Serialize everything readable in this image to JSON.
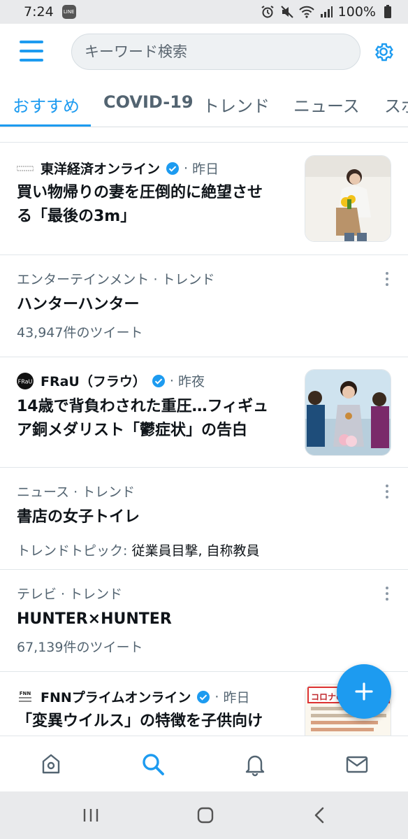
{
  "status_bar": {
    "time": "7:24",
    "line_badge": "LINE",
    "battery": "100%",
    "icons": [
      "alarm-icon",
      "mute-icon",
      "wifi-icon",
      "signal-icon",
      "battery-icon"
    ]
  },
  "header": {
    "menu_icon": "hamburger-menu-icon",
    "search_placeholder": "キーワード検索",
    "settings_icon": "gear-icon"
  },
  "tabs": [
    {
      "label": "おすすめ",
      "active": true
    },
    {
      "label": "COVID-19",
      "active": false
    },
    {
      "label": "トレンド",
      "active": false
    },
    {
      "label": "ニュース",
      "active": false
    },
    {
      "label": "スポーツ",
      "active": false
    }
  ],
  "feed": [
    {
      "type": "news",
      "source": "東洋経済オンライン",
      "time": "昨日",
      "title_line1": "買い物帰りの妻を圧倒的に絶望させ",
      "title_line2": "る「最後の3m」"
    },
    {
      "type": "trend",
      "category": "エンターテインメント · トレンド",
      "title": "ハンターハンター",
      "count": "43,947件のツイート"
    },
    {
      "type": "news",
      "source": "FRaU（フラウ）",
      "time": "昨夜",
      "title_line1": "14歳で背負わされた重圧…フィギュ",
      "title_line2": "ア銅メダリスト「鬱症状」の告白"
    },
    {
      "type": "trend",
      "category": "ニュース · トレンド",
      "title": "書店の女子トイレ",
      "topic_label": "トレンドトピック: ",
      "topics": "従業員目撃, 自称教員"
    },
    {
      "type": "trend",
      "category": "テレビ · トレンド",
      "title": "HUNTER×HUNTER",
      "count": "67,139件のツイート"
    },
    {
      "type": "news",
      "source": "FNNプライムオンライン",
      "time": "昨日",
      "title_line1": "「変異ウイルス」の特徴を子供向け",
      "thumb_text": "コロナの変異"
    }
  ],
  "colors": {
    "accent": "#1d9bf0",
    "text": "#0f1419",
    "muted": "#536471"
  }
}
